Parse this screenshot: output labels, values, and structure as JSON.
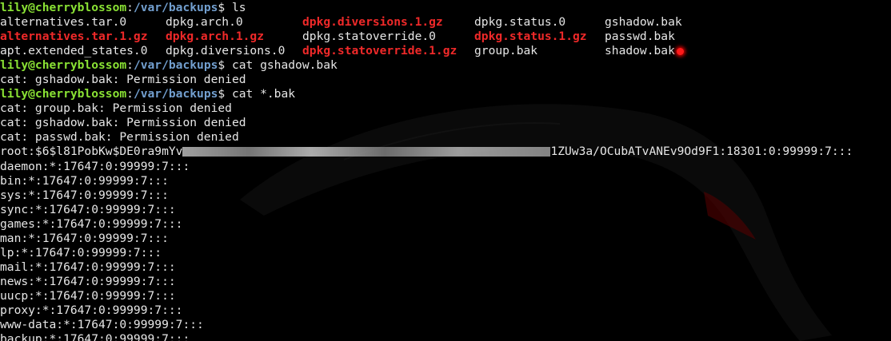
{
  "prompt": {
    "user": "lily@cherryblossom",
    "path": "/var/backups"
  },
  "commands": {
    "ls": "ls",
    "cat_gshadow": "cat gshadow.bak",
    "cat_all": "cat *.bak"
  },
  "ls_output": [
    [
      {
        "name": "alternatives.tar.0",
        "red": false
      },
      {
        "name": "dpkg.arch.0",
        "red": false
      },
      {
        "name": "dpkg.diversions.1.gz",
        "red": true
      },
      {
        "name": "dpkg.status.0",
        "red": false
      },
      {
        "name": "gshadow.bak",
        "red": false
      }
    ],
    [
      {
        "name": "alternatives.tar.1.gz",
        "red": true
      },
      {
        "name": "dpkg.arch.1.gz",
        "red": true
      },
      {
        "name": "dpkg.statoverride.0",
        "red": false
      },
      {
        "name": "dpkg.status.1.gz",
        "red": true
      },
      {
        "name": "passwd.bak",
        "red": false
      }
    ],
    [
      {
        "name": "apt.extended_states.0",
        "red": false
      },
      {
        "name": "dpkg.diversions.0",
        "red": false
      },
      {
        "name": "dpkg.statoverride.1.gz",
        "red": true
      },
      {
        "name": "group.bak",
        "red": false
      },
      {
        "name": "shadow.bak",
        "red": false
      }
    ]
  ],
  "outputs": {
    "gshadow_denied": "cat: gshadow.bak: Permission denied",
    "group_denied": "cat: group.bak: Permission denied",
    "gshadow_denied_2": "cat: gshadow.bak: Permission denied",
    "passwd_denied": "cat: passwd.bak: Permission denied",
    "root_prefix": "root:$6$l81PobKw$DE0ra9mYv",
    "root_suffix": "1ZUw3a/OCubATvANEv9Od9F1:18301:0:99999:7:::"
  },
  "shadow_lines": [
    "daemon:*:17647:0:99999:7:::",
    "bin:*:17647:0:99999:7:::",
    "sys:*:17647:0:99999:7:::",
    "sync:*:17647:0:99999:7:::",
    "games:*:17647:0:99999:7:::",
    "man:*:17647:0:99999:7:::",
    "lp:*:17647:0:99999:7:::",
    "mail:*:17647:0:99999:7:::",
    "news:*:17647:0:99999:7:::",
    "uucp:*:17647:0:99999:7:::",
    "proxy:*:17647:0:99999:7:::",
    "www-data:*:17647:0:99999:7:::",
    "backup:*:17647:0:99999:7:::"
  ],
  "colors": {
    "background": "#000000",
    "prompt_user": "#8ae234",
    "prompt_path": "#729fcf",
    "archive_red": "#ef2929",
    "text": "#e6e6e6"
  }
}
